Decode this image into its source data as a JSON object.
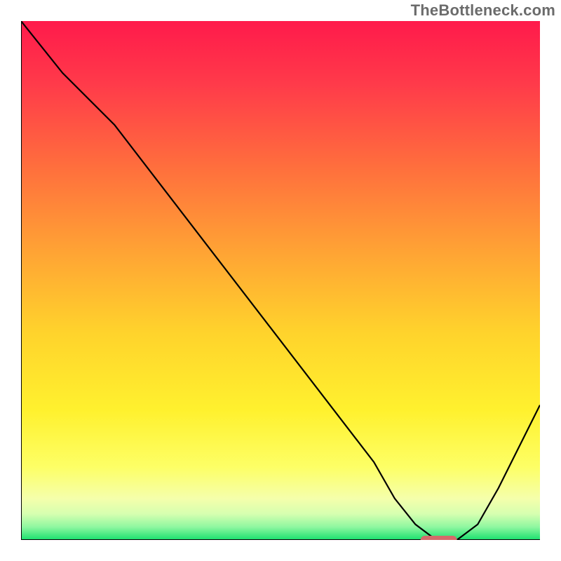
{
  "watermark": "TheBottleneck.com",
  "chart_data": {
    "type": "line",
    "title": "",
    "xlabel": "",
    "ylabel": "",
    "xlim": [
      0,
      100
    ],
    "ylim": [
      0,
      100
    ],
    "grid": false,
    "series": [
      {
        "name": "bottleneck-curve",
        "x": [
          0,
          8,
          18,
          28,
          38,
          48,
          58,
          68,
          72,
          76,
          80,
          84,
          88,
          92,
          96,
          100
        ],
        "values": [
          100,
          90,
          80,
          67,
          54,
          41,
          28,
          15,
          8,
          3,
          0,
          0,
          3,
          10,
          18,
          26
        ]
      }
    ],
    "marker": {
      "name": "optimal-range",
      "x_start": 77,
      "x_end": 84,
      "y": 0
    },
    "gradient_stops": [
      {
        "offset": 0.0,
        "color": "#ff1a4b"
      },
      {
        "offset": 0.12,
        "color": "#ff3a4a"
      },
      {
        "offset": 0.28,
        "color": "#ff6e3d"
      },
      {
        "offset": 0.45,
        "color": "#ffa534"
      },
      {
        "offset": 0.6,
        "color": "#ffd32c"
      },
      {
        "offset": 0.75,
        "color": "#fff12e"
      },
      {
        "offset": 0.86,
        "color": "#fdff66"
      },
      {
        "offset": 0.92,
        "color": "#f5ffab"
      },
      {
        "offset": 0.95,
        "color": "#d6ffb0"
      },
      {
        "offset": 0.975,
        "color": "#8ef7a0"
      },
      {
        "offset": 1.0,
        "color": "#19e06e"
      }
    ]
  }
}
